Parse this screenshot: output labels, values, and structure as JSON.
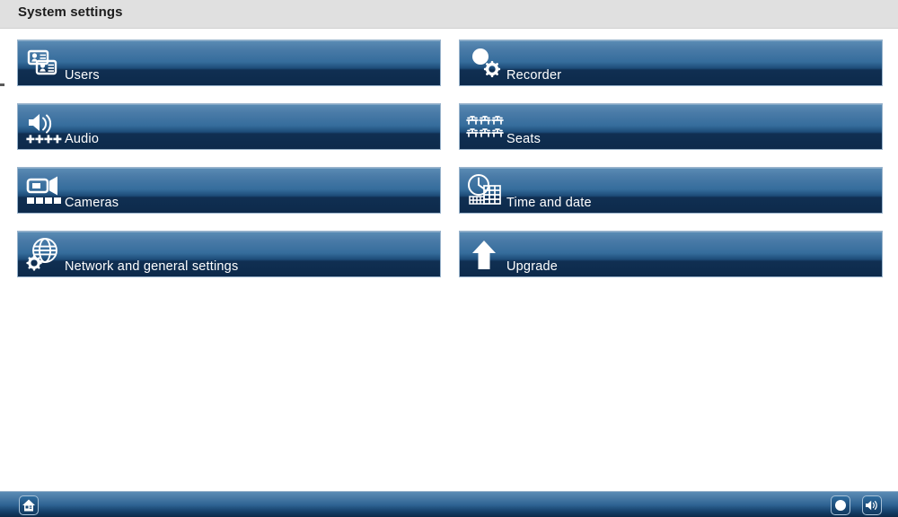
{
  "header": {
    "title": "System settings",
    "background_color": "#e0e0e0"
  },
  "theme": {
    "tile_top_color": "#5b8cb5",
    "tile_bottom_color": "#0d2a4b",
    "tile_border_color": "#9ab4cc",
    "label_color": "#ffffff",
    "page_background": "#ffffff"
  },
  "tiles": [
    {
      "label": "Users",
      "icon": "id-cards-icon",
      "column": "left",
      "row": 0
    },
    {
      "label": "Audio",
      "icon": "speaker-faders-icon",
      "column": "left",
      "row": 1
    },
    {
      "label": "Cameras",
      "icon": "video-camera-icon",
      "column": "left",
      "row": 2
    },
    {
      "label": "Network and general settings",
      "icon": "globe-gear-icon",
      "column": "left",
      "row": 3
    },
    {
      "label": "Recorder",
      "icon": "record-gear-icon",
      "column": "right",
      "row": 0
    },
    {
      "label": "Seats",
      "icon": "seats-grid-icon",
      "column": "right",
      "row": 1
    },
    {
      "label": "Time and date",
      "icon": "clock-calendar-icon",
      "column": "right",
      "row": 2
    },
    {
      "label": "Upgrade",
      "icon": "up-arrow-icon",
      "column": "right",
      "row": 3
    }
  ],
  "bottom_bar": {
    "buttons": [
      {
        "name": "home-button",
        "icon": "home-icon"
      },
      {
        "name": "record-button",
        "icon": "record-circle-icon"
      },
      {
        "name": "volume-button",
        "icon": "speaker-icon"
      }
    ]
  }
}
